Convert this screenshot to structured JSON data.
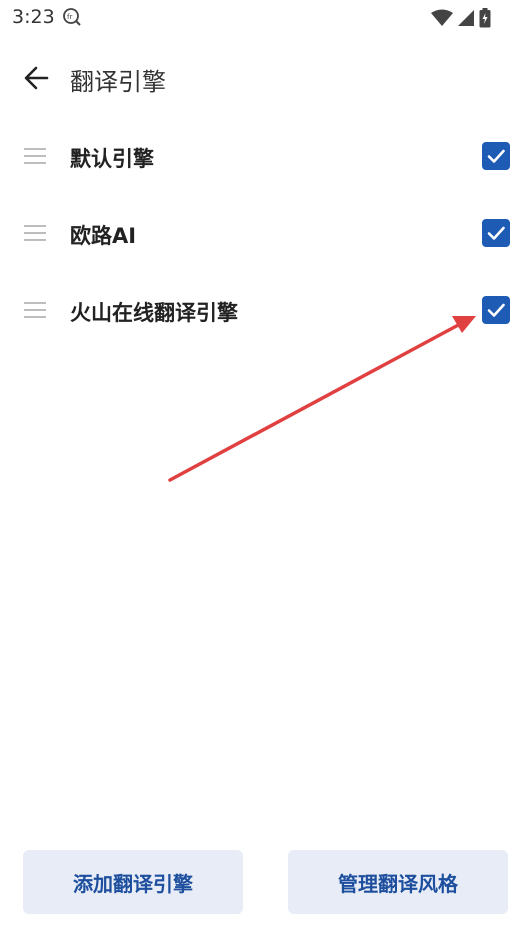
{
  "status_bar": {
    "time": "3:23",
    "icons": [
      "app-notification-icon",
      "wifi-icon",
      "signal-icon",
      "battery-icon"
    ]
  },
  "header": {
    "title": "翻译引擎",
    "back_icon": "arrow-left-icon"
  },
  "engines": [
    {
      "label": "默认引擎",
      "checked": true
    },
    {
      "label": "欧路AI",
      "checked": true
    },
    {
      "label": "火山在线翻译引擎",
      "checked": true
    }
  ],
  "footer": {
    "add_button": "添加翻译引擎",
    "manage_button": "管理翻译风格"
  },
  "colors": {
    "accent": "#1e5bb5",
    "button_bg": "#e7ecf6",
    "button_text": "#1e4f9e",
    "annotation_arrow": "#e04040"
  }
}
